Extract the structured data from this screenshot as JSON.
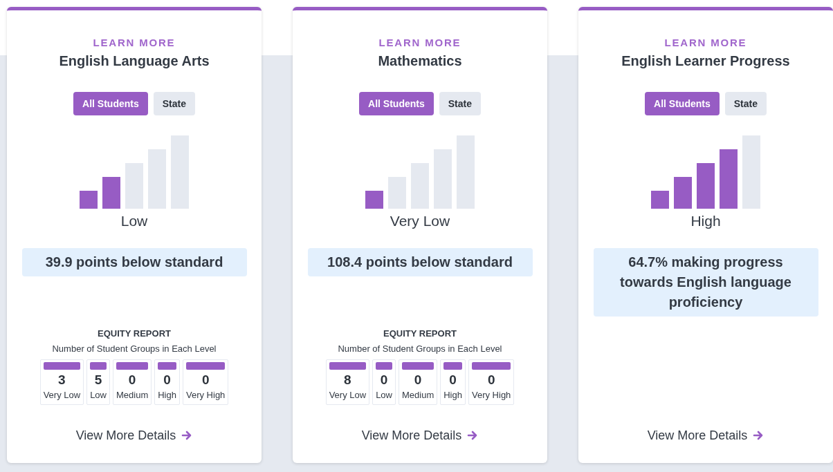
{
  "cards": [
    {
      "eyebrow": "LEARN MORE",
      "title": "English Language Arts",
      "toggles": [
        {
          "label": "All Students",
          "selected": true
        },
        {
          "label": "State",
          "selected": false
        }
      ],
      "meter": {
        "level": 0.4,
        "label": "Low"
      },
      "result": "39.9 points below standard",
      "equity": {
        "title": "EQUITY REPORT",
        "subtitle": "Number of Student Groups in Each Level",
        "levels": [
          {
            "count": "3",
            "label": "Very Low"
          },
          {
            "count": "5",
            "label": "Low"
          },
          {
            "count": "0",
            "label": "Medium"
          },
          {
            "count": "0",
            "label": "High"
          },
          {
            "count": "0",
            "label": "Very High"
          }
        ]
      },
      "link": "View More Details"
    },
    {
      "eyebrow": "LEARN MORE",
      "title": "Mathematics",
      "toggles": [
        {
          "label": "All Students",
          "selected": true
        },
        {
          "label": "State",
          "selected": false
        }
      ],
      "meter": {
        "level": 0.2,
        "label": "Very Low"
      },
      "result": "108.4 points below standard",
      "equity": {
        "title": "EQUITY REPORT",
        "subtitle": "Number of Student Groups in Each Level",
        "levels": [
          {
            "count": "8",
            "label": "Very Low"
          },
          {
            "count": "0",
            "label": "Low"
          },
          {
            "count": "0",
            "label": "Medium"
          },
          {
            "count": "0",
            "label": "High"
          },
          {
            "count": "0",
            "label": "Very High"
          }
        ]
      },
      "link": "View More Details"
    },
    {
      "eyebrow": "LEARN MORE",
      "title": "English Learner Progress",
      "toggles": [
        {
          "label": "All Students",
          "selected": true
        },
        {
          "label": "State",
          "selected": false
        }
      ],
      "meter": {
        "level": 0.8,
        "label": "High"
      },
      "result": "64.7% making progress towards English language proficiency",
      "link": "View More Details"
    }
  ]
}
